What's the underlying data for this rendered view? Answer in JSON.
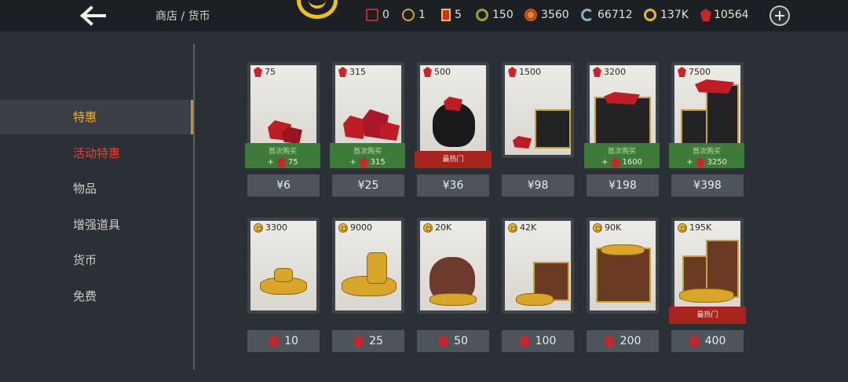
{
  "header": {
    "back_label": "back",
    "breadcrumb": "商店 / 货币",
    "resources": [
      {
        "icon": "red-token-icon",
        "value": "0",
        "color": "#b0302a"
      },
      {
        "icon": "gold-medal-icon",
        "value": "1",
        "color": "#d9a53a"
      },
      {
        "icon": "red-scroll-icon",
        "value": "5",
        "color": "#d02a2a"
      },
      {
        "icon": "green-coin-icon",
        "value": "150",
        "color": "#9aa03a"
      },
      {
        "icon": "orange-emblem-icon",
        "value": "3560",
        "color": "#d06a2a"
      },
      {
        "icon": "blue-swirl-icon",
        "value": "66712",
        "color": "#8ab0c8"
      },
      {
        "icon": "gold-coin-icon",
        "value": "137K",
        "color": "#e3b63a"
      },
      {
        "icon": "ruby-icon",
        "value": "10564",
        "color": "#c8262a"
      }
    ]
  },
  "sidebar": {
    "items": [
      {
        "label": "特惠",
        "state": "active"
      },
      {
        "label": "活动特惠",
        "state": "highlight"
      },
      {
        "label": "物品",
        "state": "normal"
      },
      {
        "label": "增强道具",
        "state": "normal"
      },
      {
        "label": "货币",
        "state": "normal"
      },
      {
        "label": "免费",
        "state": "normal"
      }
    ]
  },
  "ruby_packs": [
    {
      "amount": "75",
      "bonus_title": "首次购买",
      "bonus_prefix": "+",
      "bonus_amount": "75",
      "price": "¥6"
    },
    {
      "amount": "315",
      "bonus_title": "首次购买",
      "bonus_prefix": "+",
      "bonus_amount": "315",
      "price": "¥25"
    },
    {
      "amount": "500",
      "hot_label": "最热门",
      "price": "¥36"
    },
    {
      "amount": "1500",
      "price": "¥98"
    },
    {
      "amount": "3200",
      "bonus_title": "首次购买",
      "bonus_prefix": "+",
      "bonus_amount": "1600",
      "price": "¥198"
    },
    {
      "amount": "7500",
      "bonus_title": "首次购买",
      "bonus_prefix": "+",
      "bonus_amount": "3250",
      "price": "¥398"
    }
  ],
  "coin_packs": [
    {
      "amount": "3300",
      "cost": "10"
    },
    {
      "amount": "9000",
      "cost": "25"
    },
    {
      "amount": "20K",
      "cost": "50"
    },
    {
      "amount": "42K",
      "cost": "100"
    },
    {
      "amount": "90K",
      "cost": "200"
    },
    {
      "amount": "195K",
      "hot_label": "最热门",
      "cost": "400"
    }
  ],
  "colors": {
    "accent": "#e6b23a",
    "highlight": "#e0443a",
    "bonus": "#3e7a3a",
    "hot": "#a8241f"
  }
}
